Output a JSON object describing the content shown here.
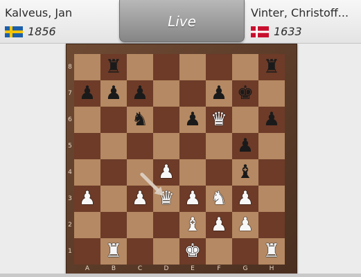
{
  "header": {
    "live_label": "Live",
    "white_player": {
      "name": "Kalveus, Jan",
      "rating": "1856",
      "flag_icon": "sweden-flag"
    },
    "black_player": {
      "name": "Vinter, Christoff...",
      "rating": "1633",
      "flag_icon": "denmark-flag"
    }
  },
  "board": {
    "orientation": "white-bottom",
    "files": [
      "A",
      "B",
      "C",
      "D",
      "E",
      "F",
      "G",
      "H"
    ],
    "ranks": [
      "8",
      "7",
      "6",
      "5",
      "4",
      "3",
      "2",
      "1"
    ],
    "colors": {
      "light": "#b58963",
      "dark": "#6d3b28",
      "frame": "#5c3b28"
    },
    "pieces": [
      {
        "square": "b8",
        "color": "b",
        "type": "rook",
        "glyph": "♜"
      },
      {
        "square": "h8",
        "color": "b",
        "type": "rook",
        "glyph": "♜"
      },
      {
        "square": "a7",
        "color": "b",
        "type": "pawn",
        "glyph": "♟"
      },
      {
        "square": "b7",
        "color": "b",
        "type": "pawn",
        "glyph": "♟"
      },
      {
        "square": "c7",
        "color": "b",
        "type": "pawn",
        "glyph": "♟"
      },
      {
        "square": "f7",
        "color": "b",
        "type": "pawn",
        "glyph": "♟"
      },
      {
        "square": "g7",
        "color": "b",
        "type": "king",
        "glyph": "♚"
      },
      {
        "square": "c6",
        "color": "b",
        "type": "knight",
        "glyph": "♞"
      },
      {
        "square": "e6",
        "color": "b",
        "type": "pawn",
        "glyph": "♟"
      },
      {
        "square": "f6",
        "color": "w",
        "type": "queen",
        "glyph": "♛"
      },
      {
        "square": "h6",
        "color": "b",
        "type": "pawn",
        "glyph": "♟"
      },
      {
        "square": "g5",
        "color": "b",
        "type": "pawn",
        "glyph": "♟"
      },
      {
        "square": "d4",
        "color": "w",
        "type": "pawn",
        "glyph": "♟"
      },
      {
        "square": "g4",
        "color": "b",
        "type": "bishop",
        "glyph": "♝"
      },
      {
        "square": "a3",
        "color": "w",
        "type": "pawn",
        "glyph": "♟"
      },
      {
        "square": "c3",
        "color": "w",
        "type": "pawn",
        "glyph": "♟"
      },
      {
        "square": "d3",
        "color": "w",
        "type": "queen",
        "glyph": "♛"
      },
      {
        "square": "e3",
        "color": "w",
        "type": "pawn",
        "glyph": "♟"
      },
      {
        "square": "f3",
        "color": "w",
        "type": "knight",
        "glyph": "♞"
      },
      {
        "square": "g3",
        "color": "w",
        "type": "pawn",
        "glyph": "♟"
      },
      {
        "square": "e2",
        "color": "w",
        "type": "bishop",
        "glyph": "♝"
      },
      {
        "square": "f2",
        "color": "w",
        "type": "pawn",
        "glyph": "♟"
      },
      {
        "square": "g2",
        "color": "w",
        "type": "pawn",
        "glyph": "♟"
      },
      {
        "square": "b1",
        "color": "w",
        "type": "rook",
        "glyph": "♜"
      },
      {
        "square": "e1",
        "color": "w",
        "type": "king",
        "glyph": "♚"
      },
      {
        "square": "h1",
        "color": "w",
        "type": "rook",
        "glyph": "♜"
      }
    ],
    "last_move": {
      "from": "c4",
      "to": "d3",
      "piece": "white queen"
    }
  }
}
